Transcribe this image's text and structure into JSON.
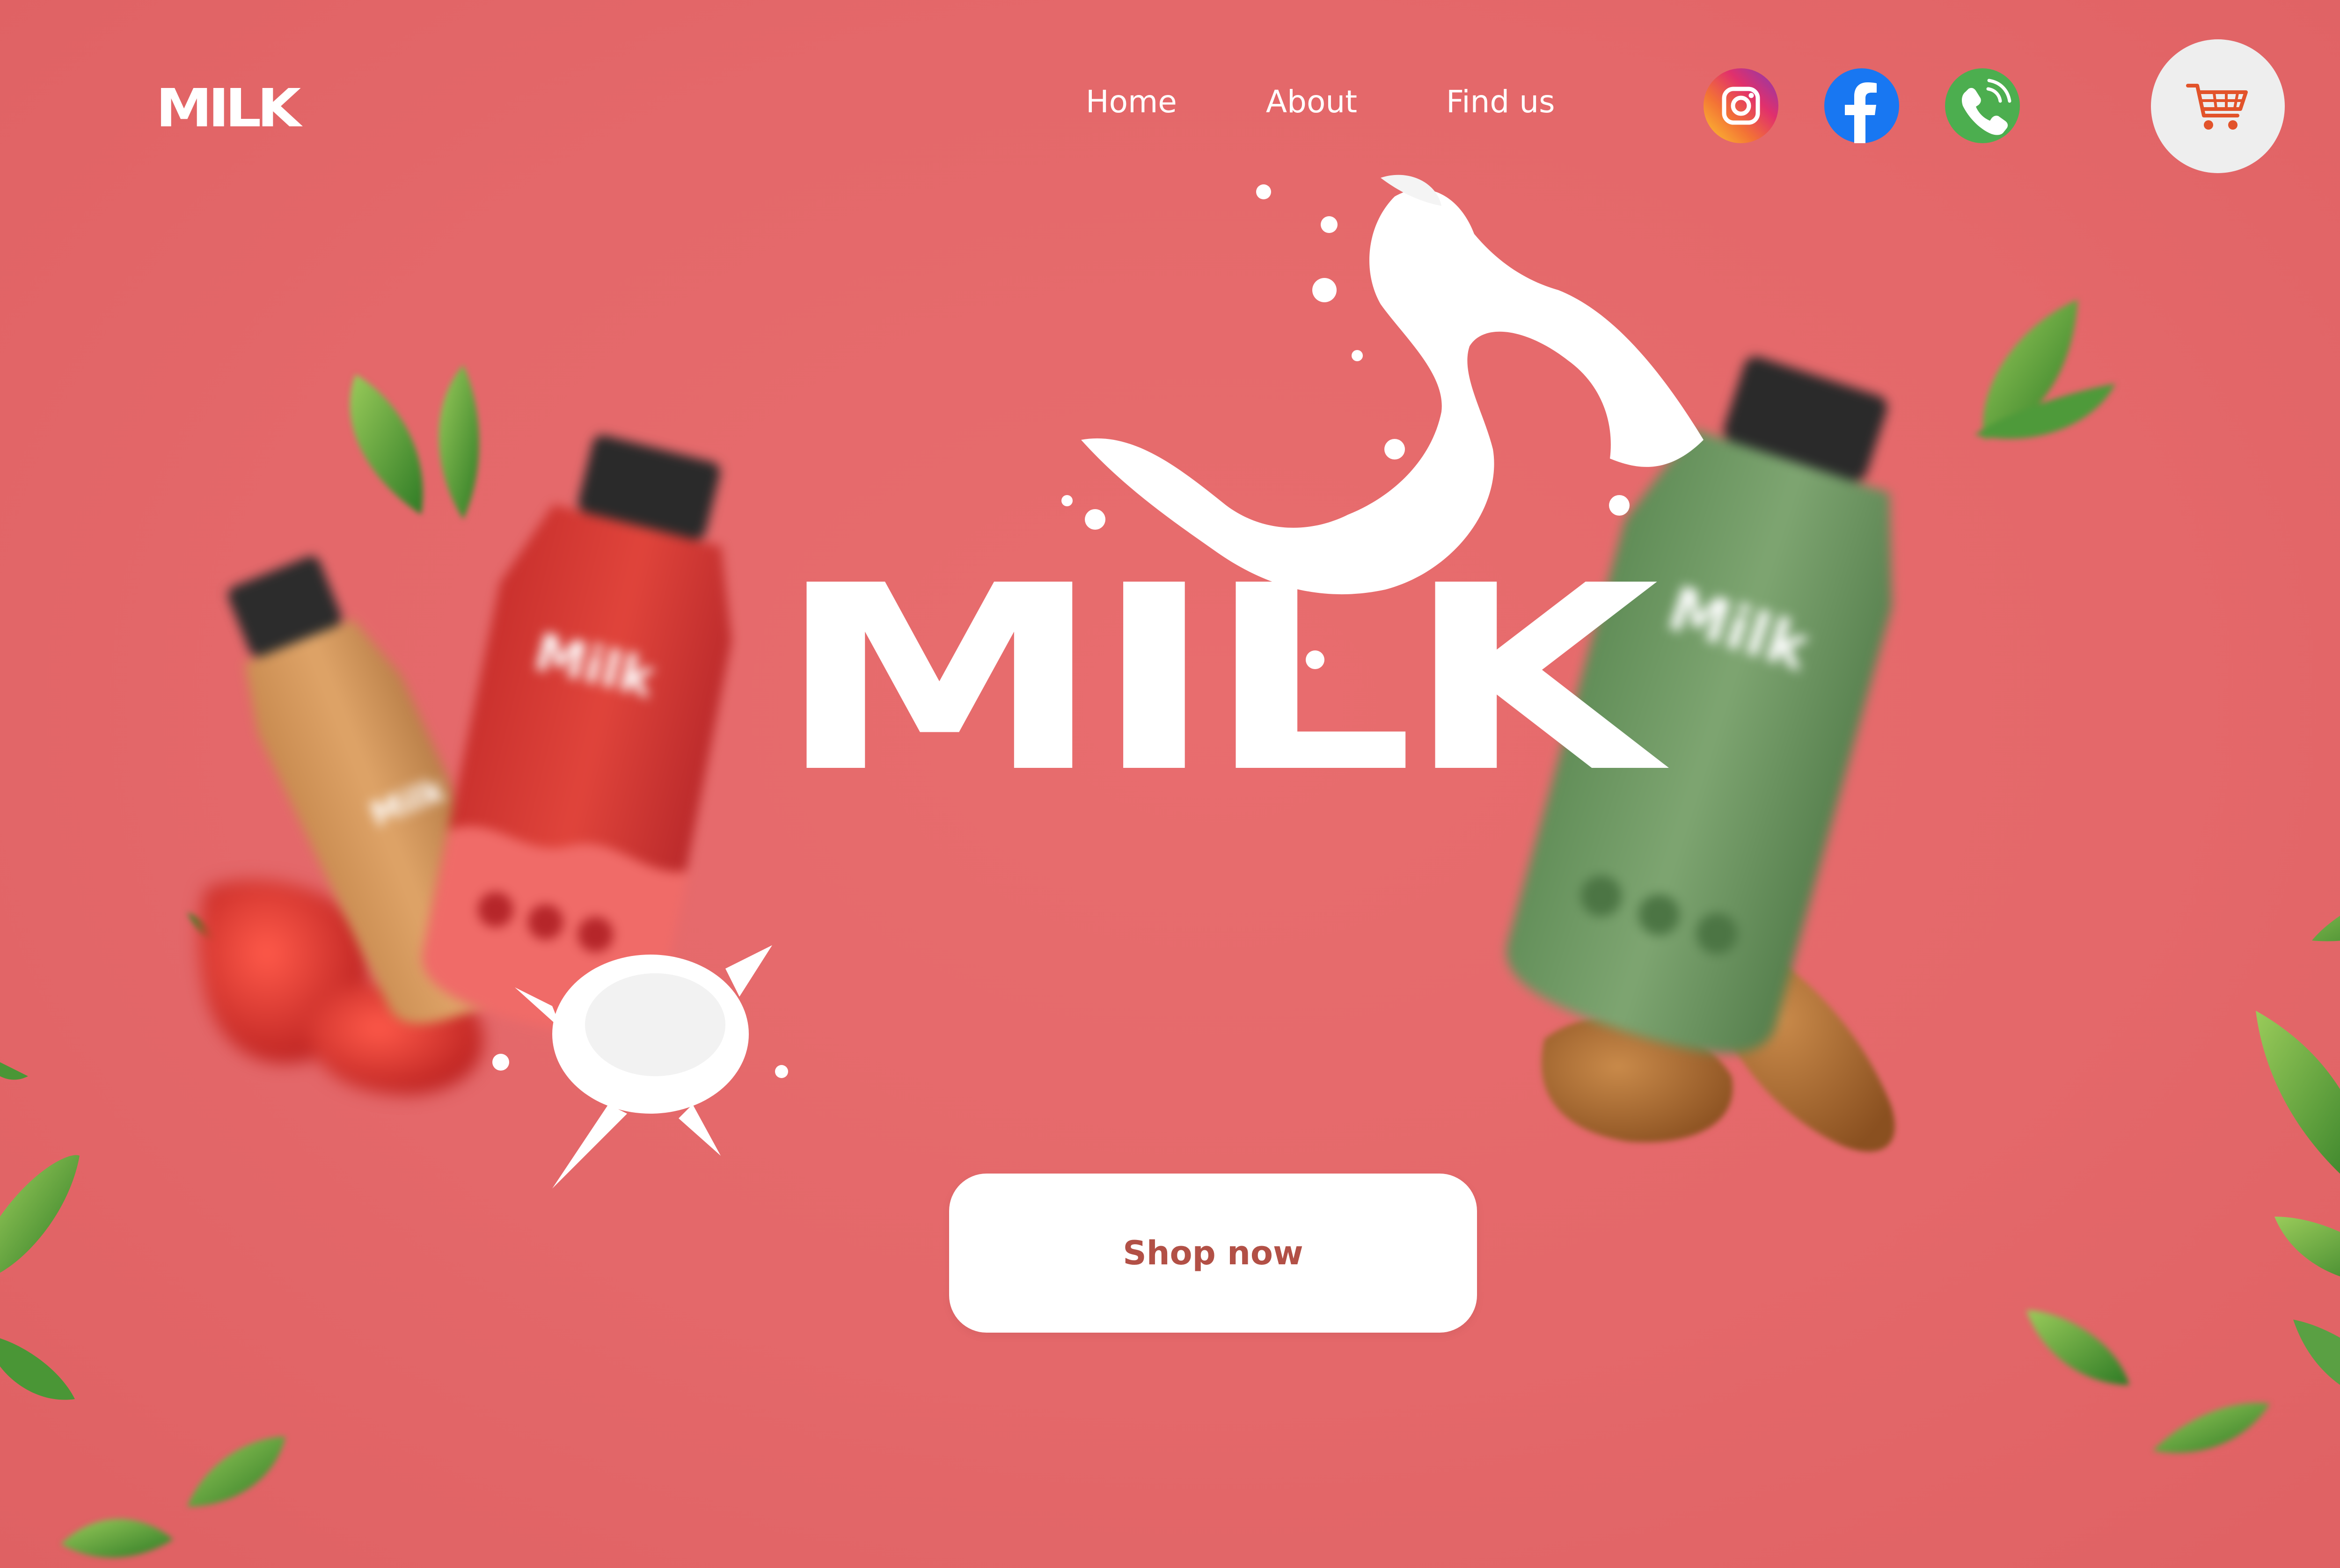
{
  "header": {
    "logo_text": "MILK",
    "nav": [
      {
        "label": "Home"
      },
      {
        "label": "About"
      },
      {
        "label": "Find us"
      }
    ],
    "socials": [
      {
        "icon": "instagram-icon"
      },
      {
        "icon": "facebook-icon"
      },
      {
        "icon": "phone-icon"
      }
    ],
    "cart_icon": "cart-icon"
  },
  "hero": {
    "title": "MILK",
    "cta_label": "Shop now"
  },
  "colors": {
    "background": "#e4686a",
    "cta_text": "#b25046",
    "cart_accent": "#e2532a",
    "instagram": "#e1306c",
    "facebook": "#1877f2",
    "phone": "#4cae4f"
  },
  "images": {
    "bottles": [
      "bottle-caramel",
      "bottle-strawberry",
      "bottle-green"
    ],
    "decor": [
      "milk-splash",
      "strawberries",
      "almonds",
      "leaves"
    ],
    "bottle_label": "Milk"
  }
}
